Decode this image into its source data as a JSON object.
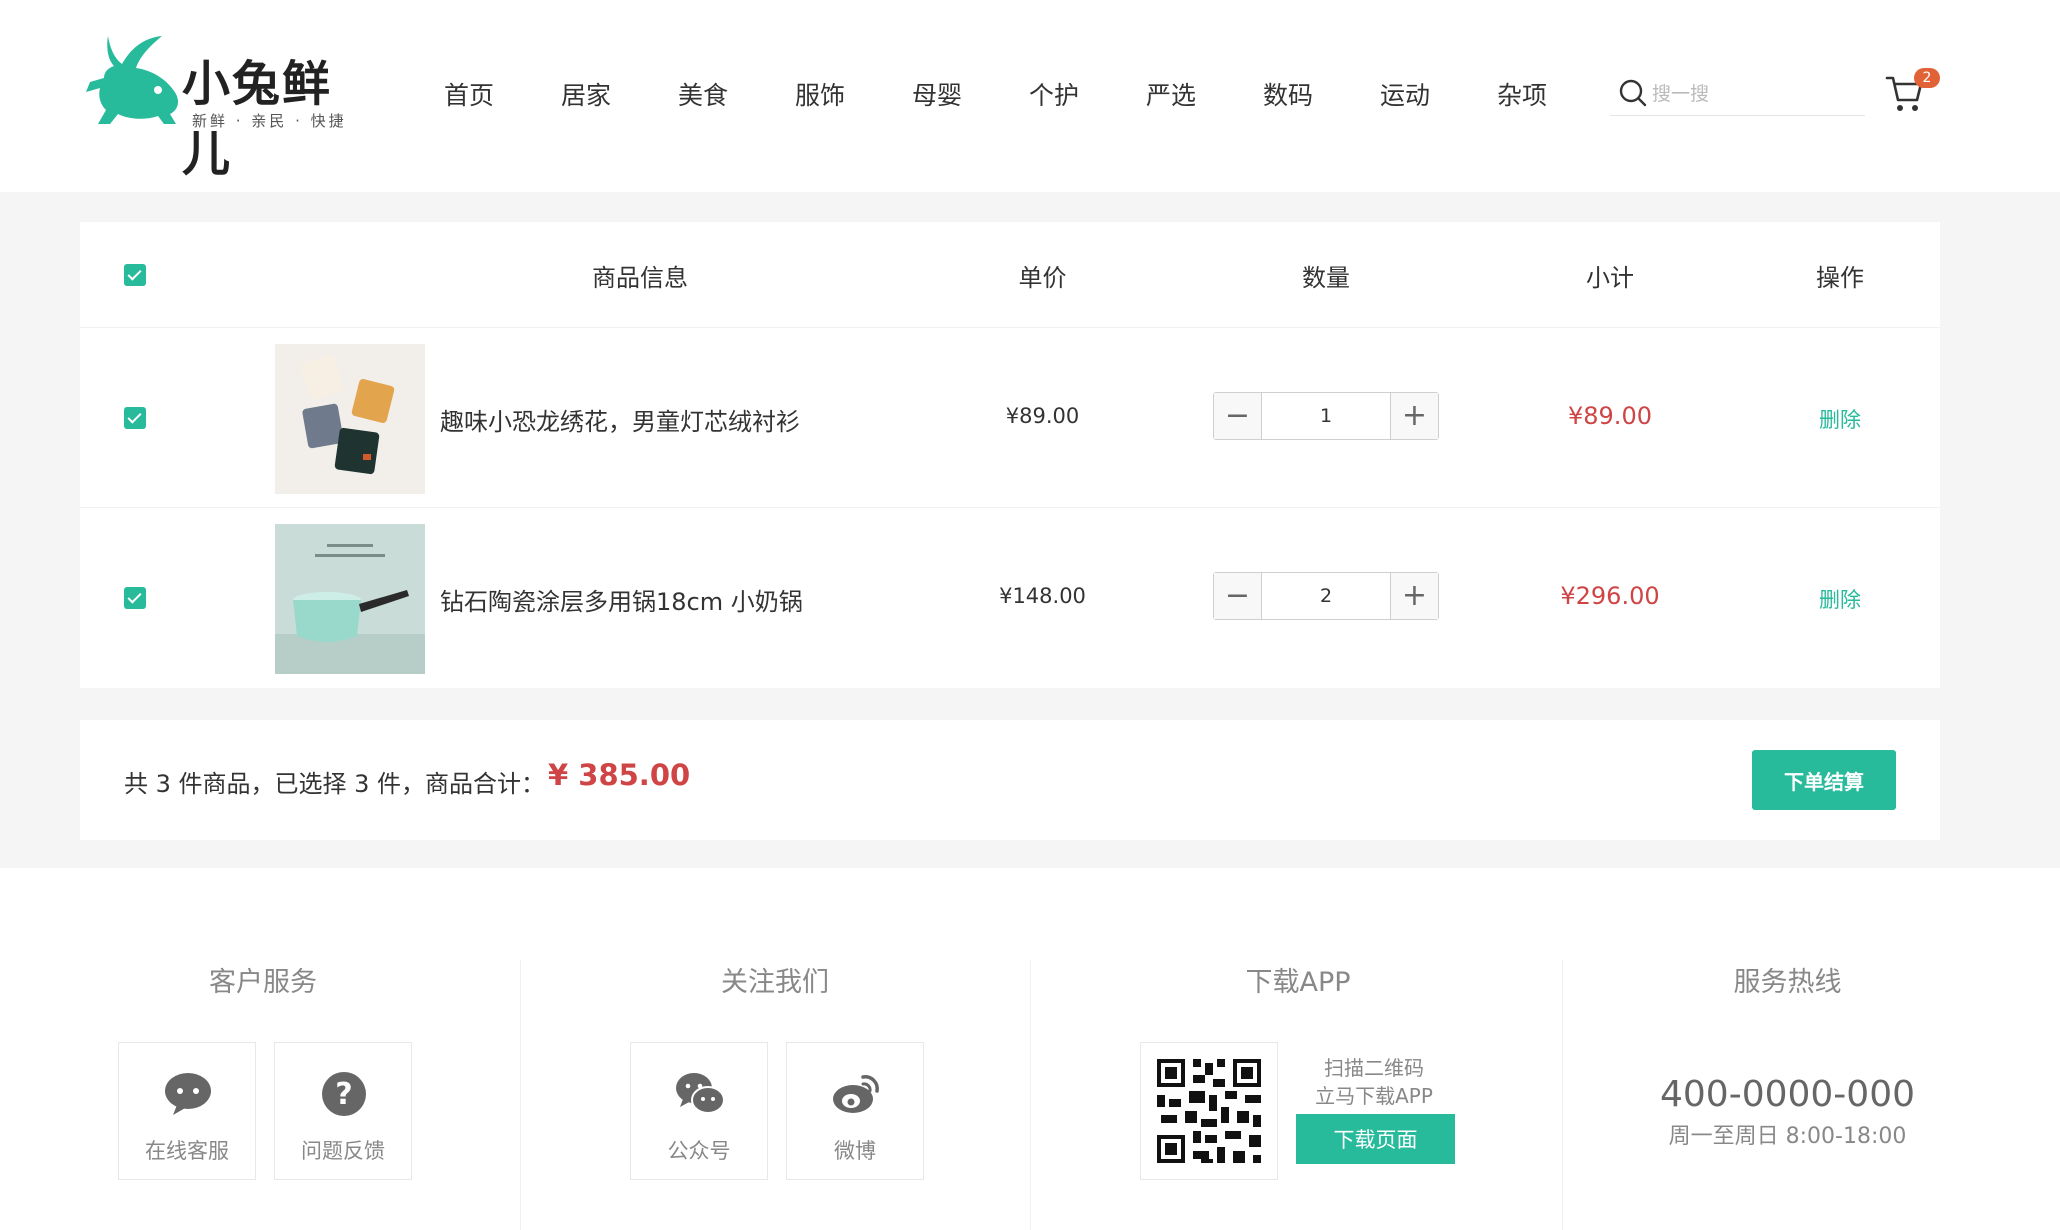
{
  "brand": {
    "name": "小兔鲜儿",
    "slogan": "新鲜 · 亲民 · 快捷",
    "accent_color": "#27ba9b",
    "price_color": "#cf4444"
  },
  "nav": {
    "items": [
      "首页",
      "居家",
      "美食",
      "服饰",
      "母婴",
      "个护",
      "严选",
      "数码",
      "运动",
      "杂项"
    ]
  },
  "search": {
    "placeholder": "搜一搜",
    "icon": "search-icon"
  },
  "cart_badge": {
    "count": "2",
    "icon": "cart-icon"
  },
  "cart": {
    "headers": {
      "info": "商品信息",
      "price": "单价",
      "quantity": "数量",
      "subtotal": "小计",
      "action": "操作"
    },
    "select_all_checked": true,
    "items": [
      {
        "checked": true,
        "name": "趣味小恐龙绣花，男童灯芯绒衬衫",
        "price": "¥89.00",
        "quantity": "1",
        "subtotal": "¥89.00",
        "delete_label": "删除",
        "minus": "−",
        "plus": "+"
      },
      {
        "checked": true,
        "name": "钻石陶瓷涂层多用锅18cm 小奶锅",
        "price": "¥148.00",
        "quantity": "2",
        "subtotal": "¥296.00",
        "delete_label": "删除",
        "minus": "−",
        "plus": "+"
      }
    ]
  },
  "summary": {
    "text": "共 3 件商品，已选择 3 件，商品合计：",
    "total": "¥ 385.00",
    "checkout_label": "下单结算"
  },
  "footer": {
    "customer_service": {
      "title": "客户服务",
      "items": [
        {
          "label": "在线客服",
          "icon": "chat-bubble-icon"
        },
        {
          "label": "问题反馈",
          "icon": "question-icon"
        }
      ]
    },
    "follow_us": {
      "title": "关注我们",
      "items": [
        {
          "label": "公众号",
          "icon": "wechat-icon"
        },
        {
          "label": "微博",
          "icon": "weibo-icon"
        }
      ]
    },
    "download_app": {
      "title": "下载APP",
      "line1": "扫描二维码",
      "line2": "立马下载APP",
      "button_label": "下载页面"
    },
    "hotline": {
      "title": "服务热线",
      "number": "400-0000-000",
      "hours": "周一至周日 8:00-18:00"
    }
  }
}
